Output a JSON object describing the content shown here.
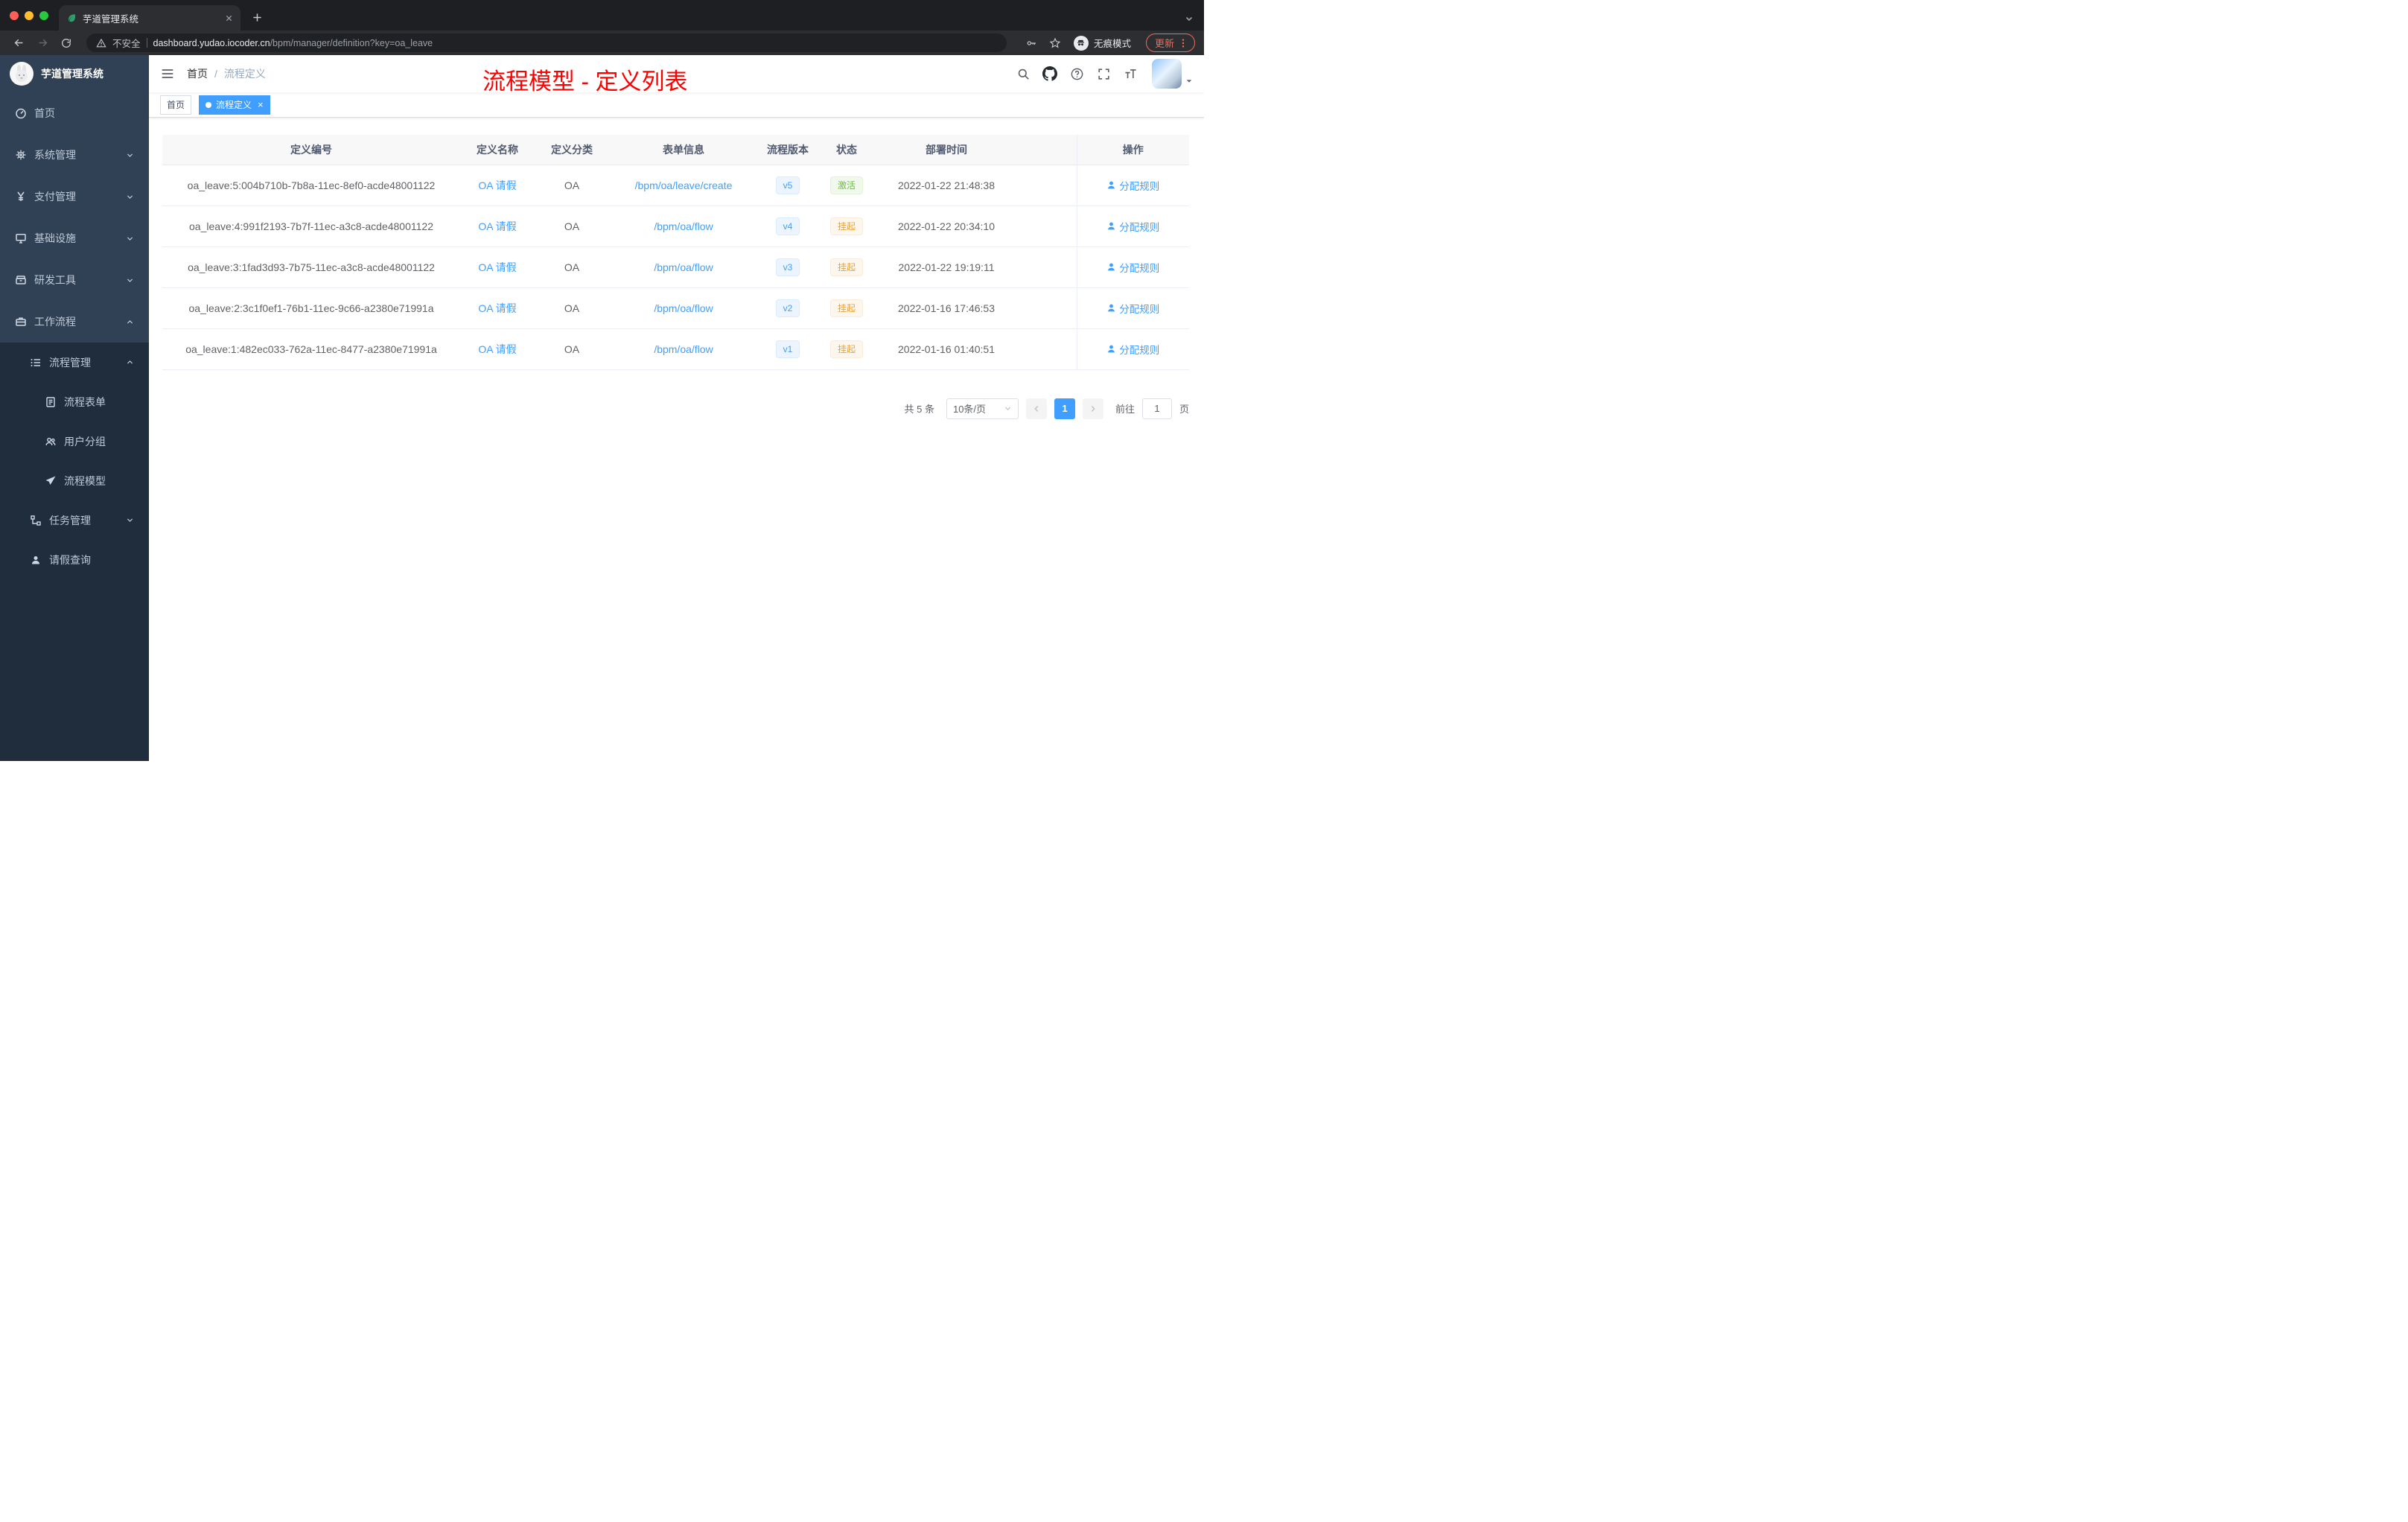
{
  "browser": {
    "tab": {
      "title": "芋道管理系统"
    },
    "address": {
      "security": "不安全",
      "domain": "dashboard.yudao.iocoder.cn",
      "path": "/bpm/manager/definition?key=oa_leave"
    },
    "incognito_label": "无痕模式",
    "update_label": "更新"
  },
  "sidebar": {
    "logo_title": "芋道管理系统",
    "items": [
      {
        "label": "首页",
        "icon": "dashboard-icon"
      },
      {
        "label": "系统管理",
        "icon": "gear-icon"
      },
      {
        "label": "支付管理",
        "icon": "yen-icon"
      },
      {
        "label": "基础设施",
        "icon": "monitor-icon"
      },
      {
        "label": "研发工具",
        "icon": "archive-icon"
      },
      {
        "label": "工作流程",
        "icon": "briefcase-icon"
      },
      {
        "label": "流程管理",
        "icon": "list-icon"
      },
      {
        "label": "流程表单",
        "icon": "form-icon"
      },
      {
        "label": "用户分组",
        "icon": "users-icon"
      },
      {
        "label": "流程模型",
        "icon": "send-icon"
      },
      {
        "label": "任务管理",
        "icon": "tree-table-icon"
      },
      {
        "label": "请假查询",
        "icon": "user-icon"
      }
    ]
  },
  "header": {
    "breadcrumb": {
      "home": "首页",
      "current": "流程定义"
    },
    "annotation": "流程模型 - 定义列表"
  },
  "tags": {
    "home": "首页",
    "active": "流程定义"
  },
  "table": {
    "columns": {
      "id": "定义编号",
      "name": "定义名称",
      "category": "定义分类",
      "form": "表单信息",
      "version": "流程版本",
      "status": "状态",
      "deploy_time": "部署时间",
      "actions": "操作"
    },
    "rows": [
      {
        "id": "oa_leave:5:004b710b-7b8a-11ec-8ef0-acde48001122",
        "name": "OA 请假",
        "category": "OA",
        "form": "/bpm/oa/leave/create",
        "version": "v5",
        "status": "激活",
        "status_type": "success",
        "time": "2022-01-22 21:48:38",
        "action": "分配规则"
      },
      {
        "id": "oa_leave:4:991f2193-7b7f-11ec-a3c8-acde48001122",
        "name": "OA 请假",
        "category": "OA",
        "form": "/bpm/oa/flow",
        "version": "v4",
        "status": "挂起",
        "status_type": "warning",
        "time": "2022-01-22 20:34:10",
        "action": "分配规则"
      },
      {
        "id": "oa_leave:3:1fad3d93-7b75-11ec-a3c8-acde48001122",
        "name": "OA 请假",
        "category": "OA",
        "form": "/bpm/oa/flow",
        "version": "v3",
        "status": "挂起",
        "status_type": "warning",
        "time": "2022-01-22 19:19:11",
        "action": "分配规则"
      },
      {
        "id": "oa_leave:2:3c1f0ef1-76b1-11ec-9c66-a2380e71991a",
        "name": "OA 请假",
        "category": "OA",
        "form": "/bpm/oa/flow",
        "version": "v2",
        "status": "挂起",
        "status_type": "warning",
        "time": "2022-01-16 17:46:53",
        "action": "分配规则"
      },
      {
        "id": "oa_leave:1:482ec033-762a-11ec-8477-a2380e71991a",
        "name": "OA 请假",
        "category": "OA",
        "form": "/bpm/oa/flow",
        "version": "v1",
        "status": "挂起",
        "status_type": "warning",
        "time": "2022-01-16 01:40:51",
        "action": "分配规则"
      }
    ]
  },
  "pagination": {
    "total": "共 5 条",
    "page_size": "10条/页",
    "page": "1",
    "goto_label": "前往",
    "goto_value": "1",
    "page_unit": "页"
  },
  "icons": {
    "favicon": "leaf-favicon",
    "security": "warning-triangle-icon",
    "navbar": [
      "search-icon",
      "github-icon",
      "question-icon",
      "fullscreen-icon",
      "font-size-icon"
    ],
    "action": "user-icon"
  },
  "colors": {
    "accent": "#409eff",
    "success": "#67c23a",
    "warning": "#e6a23c",
    "annotation": "#ff0000",
    "sidebar": "#304156",
    "submenu": "#1f2d3d"
  }
}
